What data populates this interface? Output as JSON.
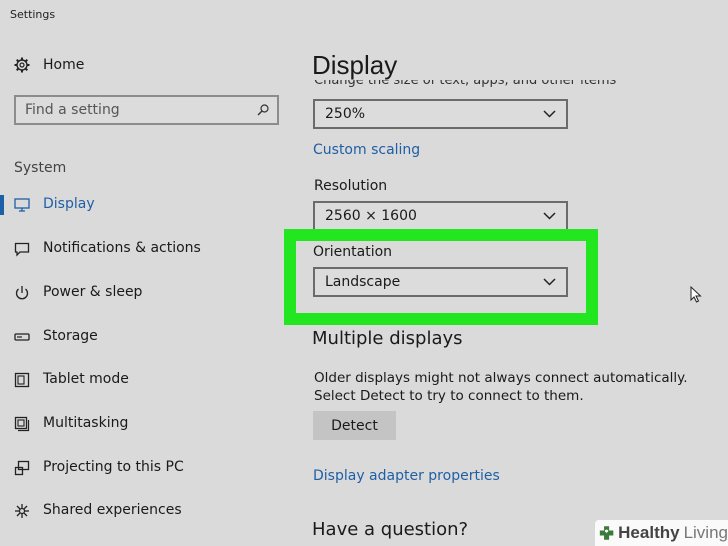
{
  "window": {
    "title": "Settings"
  },
  "sidebar": {
    "home_label": "Home",
    "search_placeholder": "Find a setting",
    "section_label": "System",
    "items": [
      {
        "label": "Display",
        "icon": "monitor-icon",
        "active": true
      },
      {
        "label": "Notifications & actions",
        "icon": "notification-icon",
        "active": false
      },
      {
        "label": "Power & sleep",
        "icon": "power-icon",
        "active": false
      },
      {
        "label": "Storage",
        "icon": "storage-icon",
        "active": false
      },
      {
        "label": "Tablet mode",
        "icon": "tablet-icon",
        "active": false
      },
      {
        "label": "Multitasking",
        "icon": "multitasking-icon",
        "active": false
      },
      {
        "label": "Projecting to this PC",
        "icon": "projecting-icon",
        "active": false
      },
      {
        "label": "Shared experiences",
        "icon": "shared-icon",
        "active": false
      }
    ]
  },
  "main": {
    "title": "Display",
    "scale_label_partial": "Change the size of text, apps, and other items",
    "scale_value": "250%",
    "custom_scaling_link": "Custom scaling",
    "resolution_label": "Resolution",
    "resolution_value": "2560 × 1600",
    "orientation_label": "Orientation",
    "orientation_value": "Landscape",
    "multiple_displays_heading": "Multiple displays",
    "multiple_displays_desc": "Older displays might not always connect automatically. Select Detect to try to connect to them.",
    "detect_button": "Detect",
    "adapter_link": "Display adapter properties",
    "question_heading": "Have a question?"
  },
  "watermark": {
    "healthy": "Healthy",
    "living": "Living"
  },
  "colors": {
    "background": "#dadada",
    "accent": "#1f5fa6",
    "highlight": "#22e620"
  }
}
